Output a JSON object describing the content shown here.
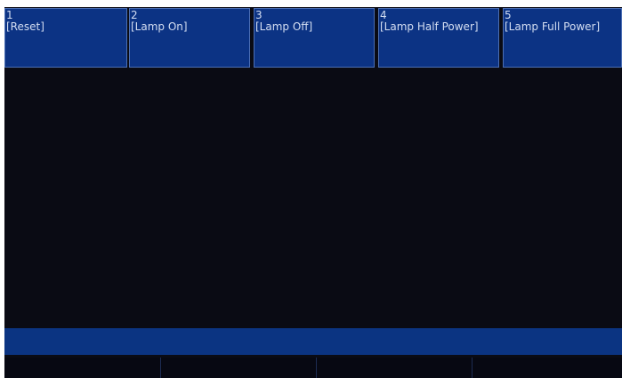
{
  "macros": [
    {
      "number": "1",
      "label": "[Reset]"
    },
    {
      "number": "2",
      "label": "[Lamp On]"
    },
    {
      "number": "3",
      "label": "[Lamp Off]"
    },
    {
      "number": "4",
      "label": "[Lamp Half Power]"
    },
    {
      "number": "5",
      "label": "[Lamp Full Power]"
    }
  ],
  "colors": {
    "background": "#0a0b14",
    "button": "#0c3384",
    "button_border": "#4c6fb4",
    "button_text": "#d4def2",
    "status_bar": "#0b3482"
  }
}
